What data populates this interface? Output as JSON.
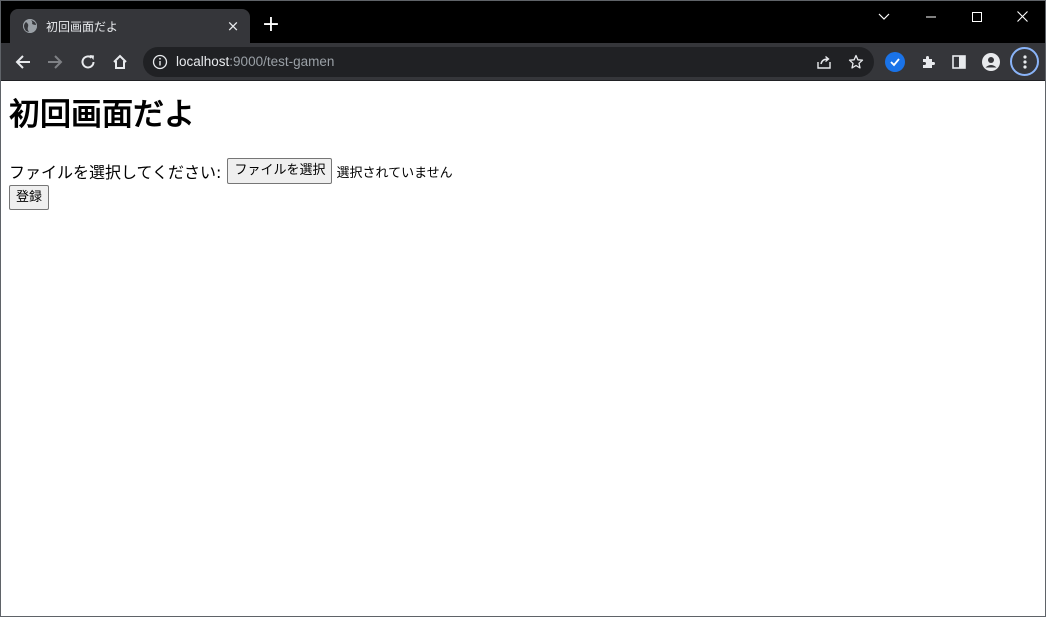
{
  "browser": {
    "tab": {
      "title": "初回画面だよ",
      "close_glyph": "×",
      "favicon": "globe-icon"
    },
    "new_tab_glyph": "+",
    "window_controls": [
      "chevron-down-icon",
      "minimize-icon",
      "maximize-icon",
      "close-icon"
    ],
    "address": {
      "host": "localhost",
      "rest": ":9000/test-gamen"
    },
    "colors": {
      "tabstrip": "#000000",
      "toolbar": "#35363a",
      "omnibox": "#202124",
      "accent": "#8ab4f8"
    }
  },
  "page": {
    "heading": "初回画面だよ",
    "file_label": "ファイルを選択してください:",
    "file_button": "ファイルを選択",
    "file_status": "選択されていません",
    "submit_button": "登録"
  }
}
